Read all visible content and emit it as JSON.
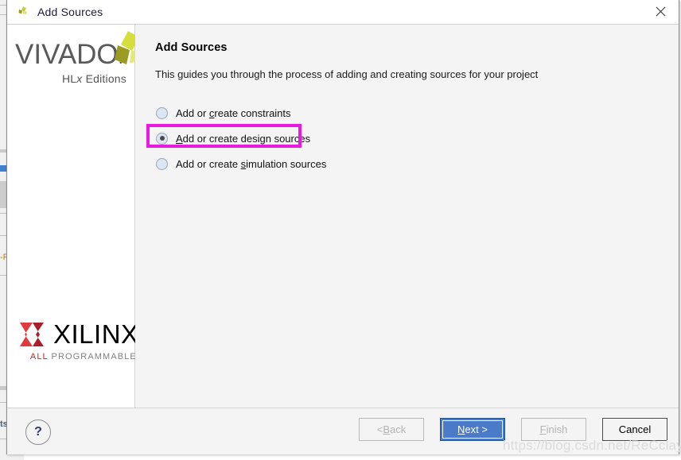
{
  "window": {
    "title": "Add Sources",
    "title_icon": "vivado-leaf-icon",
    "close_icon": "close-icon"
  },
  "branding": {
    "vivado_word": "VIVADO",
    "vivado_dot": ".",
    "vivado_sub_pre": "HL",
    "vivado_sub_italic": "x",
    "vivado_sub_post": " Editions",
    "vivado_mark_icon": "vivado-tri-leaf-icon",
    "xilinx_word": "XILINX",
    "xilinx_mark_icon": "xilinx-chevron-icon",
    "xilinx_tag_all": "ALL",
    "xilinx_tag_rest": " PROGRAMMABLE."
  },
  "main": {
    "heading": "Add Sources",
    "description": "This guides you through the process of adding and creating sources for your project",
    "options": [
      {
        "id": "constraints",
        "pre": "Add or ",
        "mnemonic": "c",
        "post": "reate constraints",
        "checked": false,
        "highlighted": false
      },
      {
        "id": "design-sources",
        "pre": "",
        "mnemonic": "A",
        "post": "dd or create design sources",
        "checked": true,
        "highlighted": true
      },
      {
        "id": "simulation-sources",
        "pre": "Add or create ",
        "mnemonic": "s",
        "post": "imulation sources",
        "checked": false,
        "highlighted": false
      }
    ],
    "highlight_color": "#ea1ae0"
  },
  "footer": {
    "help_label": "?",
    "buttons": [
      {
        "id": "back",
        "pre": "< ",
        "mnemonic": "B",
        "post": "ack",
        "state": "disabled"
      },
      {
        "id": "next",
        "pre": "",
        "mnemonic": "N",
        "post": "ext >",
        "state": "primary"
      },
      {
        "id": "finish",
        "pre": "",
        "mnemonic": "F",
        "post": "inish",
        "state": "disabled"
      },
      {
        "id": "cancel",
        "pre": "",
        "mnemonic": "",
        "post": "Cancel",
        "state": "enabled"
      }
    ]
  },
  "watermark": "https://blog.csdn.net/ReCclay",
  "background_window": {
    "fragment_1": "-F",
    "fragment_2": "ts"
  }
}
